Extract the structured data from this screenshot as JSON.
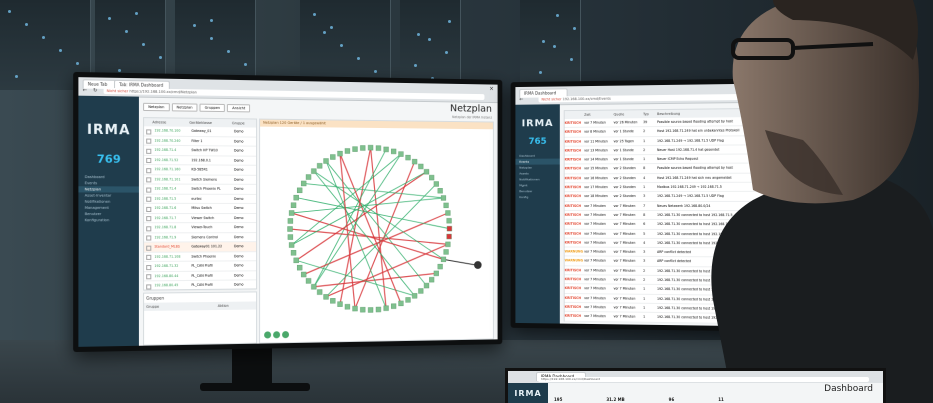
{
  "left_monitor": {
    "browser": {
      "tab_home": "Neue Tab",
      "tab_active": "Tab: IRMA Dashboard",
      "url_warning": "Nicht sicher",
      "url": "https://192.168.100.xx/cmd/Netzplan"
    },
    "sidebar": {
      "logo": "IRMA",
      "counter": "769",
      "items": [
        "Dashboard",
        "Events",
        "Netzplan",
        "Asset-Inventar",
        "Notifikationen",
        "Management",
        "Benutzer",
        "Konfiguration"
      ]
    },
    "toolbar": {
      "buttons": [
        "Netzplan",
        "Netzplan",
        "Gruppen",
        "Ansicht"
      ]
    },
    "page_title": "Netzplan",
    "page_subtitle": "Netzplan der IRMA Instanz",
    "table": {
      "headers": [
        "Adresse",
        "Geräteklasse",
        "Gruppe"
      ],
      "rows": [
        {
          "ip": "192.168.70.100",
          "name": "Gateway_01",
          "group": "Demo"
        },
        {
          "ip": "192.168.70.240",
          "name": "Filter 1",
          "group": "Demo"
        },
        {
          "ip": "192.168.71.4",
          "name": "Switch HP TW10",
          "group": "Demo"
        },
        {
          "ip": "192.168.71.52",
          "name": "192.168.0.1",
          "group": "Demo"
        },
        {
          "ip": "192.168.71.160",
          "name": "KD-5B5R1",
          "group": "Demo"
        },
        {
          "ip": "192.168.71.101",
          "name": "Switch Siemens",
          "group": "Demo"
        },
        {
          "ip": "192.168.71.4",
          "name": "Switch Phoenix PL",
          "group": "Demo"
        },
        {
          "ip": "192.168.71.5",
          "name": "eurtec",
          "group": "Demo"
        },
        {
          "ip": "192.168.71.6",
          "name": "Mitsu Switch",
          "group": "Demo"
        },
        {
          "ip": "192.168.71.7",
          "name": "Viewer Switch",
          "group": "Demo"
        },
        {
          "ip": "192.168.71.8",
          "name": "Viewer-Touch",
          "group": "Demo"
        },
        {
          "ip": "192.168.71.9",
          "name": "Siemens Control",
          "group": "Demo"
        },
        {
          "ip": "Standard_MLBS",
          "name": "Gateway01 101.22",
          "group": "Demo"
        },
        {
          "ip": "192.168.71.108",
          "name": "Switch Phoenix",
          "group": "Demo"
        },
        {
          "ip": "192.168.71.32",
          "name": "PL_CAN Profil",
          "group": "Demo"
        },
        {
          "ip": "192.168.80.44",
          "name": "PL_CAN Profil",
          "group": "Demo"
        },
        {
          "ip": "192.168.80.45",
          "name": "PL_CAN Profil",
          "group": "Demo"
        },
        {
          "ip": "192.168.80.46",
          "name": "PL_CAN Profil",
          "group": "Demo"
        }
      ]
    },
    "groups_panel": {
      "title": "Gruppen",
      "col1": "Gruppe",
      "col2": "Aktion"
    },
    "graph_banner": "Netzplan 120 Geräte / 1 ausgewählt"
  },
  "right_monitor": {
    "browser": {
      "tab_active": "IRMA Dashboard",
      "url_warning": "Nicht sicher",
      "url": "192.168.100.xx/cmd/Events"
    },
    "sidebar": {
      "logo": "IRMA",
      "counter": "765",
      "items": [
        "Dashboard",
        "Events",
        "Netzplan",
        "Assets",
        "Notifikationen",
        "Mgmt",
        "Benutzer",
        "Konfig"
      ]
    },
    "table": {
      "headers": [
        "Zeit",
        "Quelle",
        "Ziel",
        "Typ",
        "Beschreibung"
      ],
      "rows": [
        {
          "level": "KRITISCH",
          "time": "vor 7 Minuten",
          "src": "vor 26 Minuten",
          "type": "39",
          "desc": "Possible source-based flooding attempt by host"
        },
        {
          "level": "KRITISCH",
          "time": "vor 8 Minuten",
          "src": "vor 1 Stunde",
          "type": "2",
          "desc": "Host 192.168.71.249 hat ein unbekanntes Protokoll"
        },
        {
          "level": "KRITISCH",
          "time": "vor 11 Minuten",
          "src": "vor 25 Tagen",
          "type": "1",
          "desc": "192.168.71.249 → 192.168.71.5 UDP Flag"
        },
        {
          "level": "KRITISCH",
          "time": "vor 13 Minuten",
          "src": "vor 1 Stunde",
          "type": "2",
          "desc": "Neuer Host 192.168.71.4 hat gesendet"
        },
        {
          "level": "KRITISCH",
          "time": "vor 14 Minuten",
          "src": "vor 1 Stunde",
          "type": "1",
          "desc": "Neuer ICMP Echo Request"
        },
        {
          "level": "KRITISCH",
          "time": "vor 15 Minuten",
          "src": "vor 2 Stunden",
          "type": "8",
          "desc": "Possible source-based flooding attempt by host"
        },
        {
          "level": "KRITISCH",
          "time": "vor 16 Minuten",
          "src": "vor 2 Stunden",
          "type": "4",
          "desc": "Host 192.168.71.249 hat sich neu angemeldet"
        },
        {
          "level": "KRITISCH",
          "time": "vor 17 Minuten",
          "src": "vor 2 Stunden",
          "type": "1",
          "desc": "Modbus 192.168.71.249 → 192.168.71.5"
        },
        {
          "level": "KRITISCH",
          "time": "vor 18 Minuten",
          "src": "vor 2 Stunden",
          "type": "3",
          "desc": "192.168.71.249 → 192.168.71.5 UDP Flag"
        },
        {
          "level": "KRITISCH",
          "time": "vor 7 Minuten",
          "src": "vor 7 Minuten",
          "type": "7",
          "desc": "Neues Netzwerk 192.168.80.0/24"
        },
        {
          "level": "KRITISCH",
          "time": "vor 7 Minuten",
          "src": "vor 7 Minuten",
          "type": "8",
          "desc": "192.168.71.30 connected to host 192.168.71.5"
        },
        {
          "level": "KRITISCH",
          "time": "vor 7 Minuten",
          "src": "vor 7 Minuten",
          "type": "6",
          "desc": "192.168.71.30 connected to host 192.168.71.6"
        },
        {
          "level": "KRITISCH",
          "time": "vor 7 Minuten",
          "src": "vor 7 Minuten",
          "type": "5",
          "desc": "192.168.71.30 connected to host 192.168.71.7"
        },
        {
          "level": "KRITISCH",
          "time": "vor 7 Minuten",
          "src": "vor 7 Minuten",
          "type": "4",
          "desc": "192.168.71.30 connected to host 192.168.71.8"
        },
        {
          "level": "WARNUNG",
          "time": "vor 7 Minuten",
          "src": "vor 7 Minuten",
          "type": "3",
          "desc": "ARP conflict detected"
        },
        {
          "level": "WARNUNG",
          "time": "vor 7 Minuten",
          "src": "vor 7 Minuten",
          "type": "3",
          "desc": "ARP conflict detected"
        },
        {
          "level": "KRITISCH",
          "time": "vor 7 Minuten",
          "src": "vor 7 Minuten",
          "type": "2",
          "desc": "192.168.71.30 connected to host 192.168.71.9"
        },
        {
          "level": "KRITISCH",
          "time": "vor 7 Minuten",
          "src": "vor 7 Minuten",
          "type": "2",
          "desc": "192.168.71.30 connected to host 192.168.71.10"
        },
        {
          "level": "KRITISCH",
          "time": "vor 7 Minuten",
          "src": "vor 7 Minuten",
          "type": "1",
          "desc": "192.168.71.30 connected to host 192.168.71.11"
        },
        {
          "level": "KRITISCH",
          "time": "vor 7 Minuten",
          "src": "vor 7 Minuten",
          "type": "1",
          "desc": "192.168.71.30 connected to host 192.168.71.12"
        },
        {
          "level": "KRITISCH",
          "time": "vor 7 Minuten",
          "src": "vor 7 Minuten",
          "type": "1",
          "desc": "192.168.71.30 connected to host 192.168.71.13"
        },
        {
          "level": "KRITISCH",
          "time": "vor 7 Minuten",
          "src": "vor 7 Minuten",
          "type": "1",
          "desc": "192.168.71.30 connected to host 192.168.71.14"
        },
        {
          "level": "KRITISCH",
          "time": "vor 7 Minuten",
          "src": "vor 7 Minuten",
          "type": "1",
          "desc": "192.168.71.30 connected to host 192.168.71.15"
        }
      ]
    }
  },
  "laptop": {
    "tab_active": "IRMA Dashboard",
    "url": "https://192.168.100.xx/cmd/Dashboard",
    "logo": "IRMA",
    "title": "Dashboard",
    "stats": [
      "195",
      "31.2 MB",
      "96",
      "11"
    ]
  },
  "colors": {
    "sidebar": "#1f3c4c",
    "accent": "#38c0f0",
    "ip_green": "#3aa35a",
    "critical": "#e2452f",
    "warning": "#f0a020",
    "graph_red": "#d8363a",
    "graph_green": "#2fae6a"
  }
}
